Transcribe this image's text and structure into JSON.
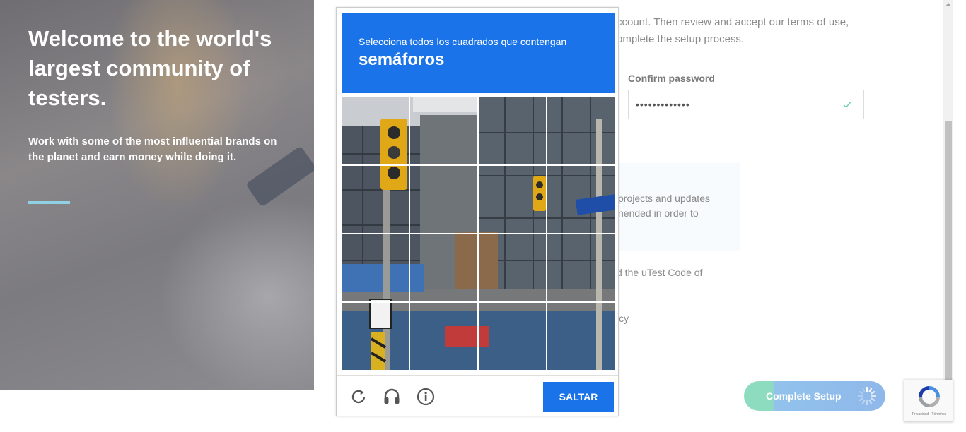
{
  "hero": {
    "title": "Welcome to the world's largest community of testers.",
    "subtitle": "Work with some of the most influential brands on the planet and earn money while doing it."
  },
  "form": {
    "intro_text": "ccount. Then review and accept our terms of use, omplete the setup process.",
    "confirm_password_label": "Confirm password",
    "confirm_password_value": "•••••••••••••",
    "info_text": "projects and updates nended in order to",
    "code_prefix": "d the ",
    "code_link": "uTest Code of",
    "policy_fragment": "icy",
    "complete_setup_label": "Complete Setup"
  },
  "captcha": {
    "instruction": "Selecciona todos los cuadrados que contengan",
    "target": "semáforos",
    "skip_label": "SALTAR",
    "header_color": "#1a73e8",
    "icons": [
      "reload-icon",
      "audio-icon",
      "info-icon"
    ]
  },
  "recaptcha_badge": {
    "links": "Privacidad - Términos"
  },
  "colors": {
    "accent_blue": "#1a73e8",
    "complete_green": "#8edcc0",
    "complete_blue": "#8fb8ea",
    "hero_rule": "#8fd0e3"
  }
}
